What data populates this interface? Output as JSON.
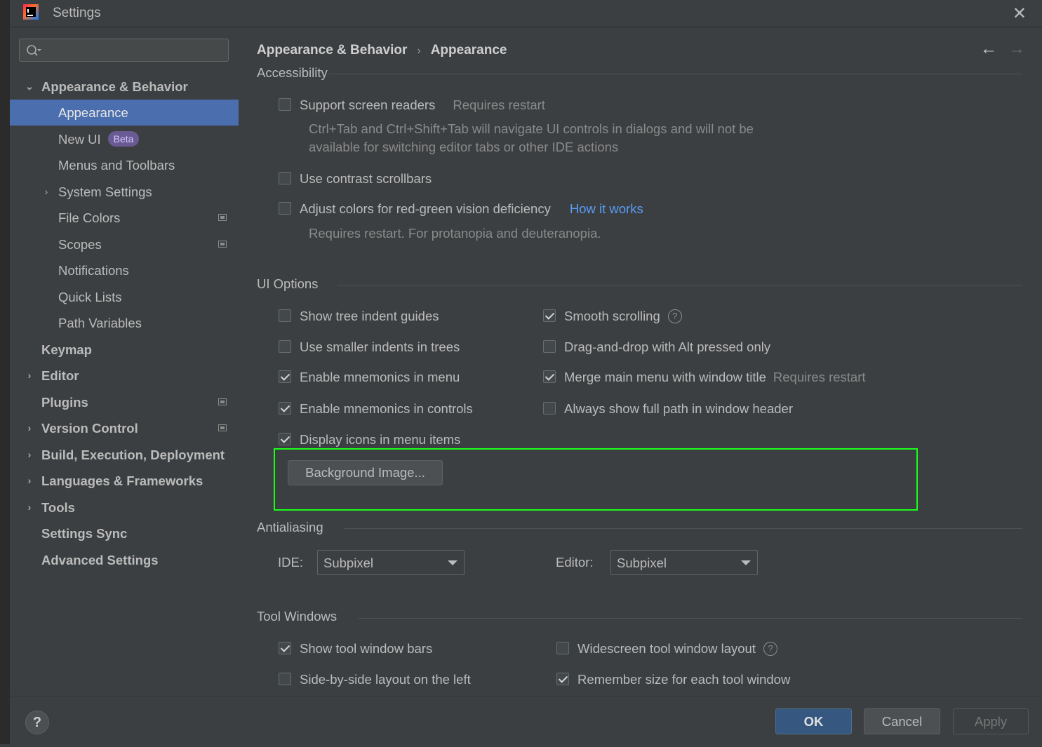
{
  "window": {
    "title": "Settings"
  },
  "search": {
    "placeholder": ""
  },
  "sidebar": {
    "items": [
      {
        "label": "Appearance & Behavior"
      },
      {
        "label": "Appearance"
      },
      {
        "label": "New UI",
        "badge": "Beta"
      },
      {
        "label": "Menus and Toolbars"
      },
      {
        "label": "System Settings"
      },
      {
        "label": "File Colors"
      },
      {
        "label": "Scopes"
      },
      {
        "label": "Notifications"
      },
      {
        "label": "Quick Lists"
      },
      {
        "label": "Path Variables"
      },
      {
        "label": "Keymap"
      },
      {
        "label": "Editor"
      },
      {
        "label": "Plugins"
      },
      {
        "label": "Version Control"
      },
      {
        "label": "Build, Execution, Deployment"
      },
      {
        "label": "Languages & Frameworks"
      },
      {
        "label": "Tools"
      },
      {
        "label": "Settings Sync"
      },
      {
        "label": "Advanced Settings"
      }
    ]
  },
  "breadcrumb": {
    "parent": "Appearance & Behavior",
    "current": "Appearance",
    "separator": "›"
  },
  "accessibility": {
    "title": "Accessibility",
    "screen_readers": {
      "label": "Support screen readers",
      "checked": false,
      "hint": "Requires restart"
    },
    "screen_readers_desc_1": "Ctrl+Tab and Ctrl+Shift+Tab will navigate UI controls in dialogs and will not be",
    "screen_readers_desc_2": "available for switching editor tabs or other IDE actions",
    "contrast_scrollbars": {
      "label": "Use contrast scrollbars",
      "checked": false
    },
    "red_green": {
      "label": "Adjust colors for red-green vision deficiency",
      "checked": false,
      "link": "How it works"
    },
    "red_green_desc": "Requires restart. For protanopia and deuteranopia."
  },
  "ui_options": {
    "title": "UI Options",
    "tree_indent_guides": {
      "label": "Show tree indent guides",
      "checked": false
    },
    "smaller_indents": {
      "label": "Use smaller indents in trees",
      "checked": false
    },
    "mnemonics_menu": {
      "label": "Enable mnemonics in menu",
      "checked": true
    },
    "mnemonics_controls": {
      "label": "Enable mnemonics in controls",
      "checked": true
    },
    "icons_in_menu": {
      "label": "Display icons in menu items",
      "checked": true
    },
    "smooth_scrolling": {
      "label": "Smooth scrolling",
      "checked": true
    },
    "drag_drop_alt": {
      "label": "Drag-and-drop with Alt pressed only",
      "checked": false
    },
    "merge_menu": {
      "label": "Merge main menu with window title",
      "checked": true,
      "hint": "Requires restart"
    },
    "full_path": {
      "label": "Always show full path in window header",
      "checked": false
    },
    "background_image_button": "Background Image..."
  },
  "antialiasing": {
    "title": "Antialiasing",
    "ide_label": "IDE:",
    "ide_value": "Subpixel",
    "editor_label": "Editor:",
    "editor_value": "Subpixel"
  },
  "tool_windows": {
    "title": "Tool Windows",
    "tool_window_bars": {
      "label": "Show tool window bars",
      "checked": true
    },
    "side_by_side": {
      "label": "Side-by-side layout on the left",
      "checked": false
    },
    "widescreen": {
      "label": "Widescreen tool window layout",
      "checked": false
    },
    "remember_size": {
      "label": "Remember size for each tool window",
      "checked": true
    }
  },
  "footer": {
    "help": "?",
    "ok": "OK",
    "cancel": "Cancel",
    "apply": "Apply"
  },
  "icons": {
    "close": "close-icon",
    "back": "arrow-left-icon",
    "forward": "arrow-right-icon",
    "search": "search-icon",
    "help": "question-circle-icon",
    "project": "project-level-icon"
  },
  "colors": {
    "accent": "#4b6eaf",
    "ok_button": "#365880",
    "link": "#589df6",
    "highlight_frame": "#19ff19",
    "beta_badge": "#6a5a94"
  }
}
